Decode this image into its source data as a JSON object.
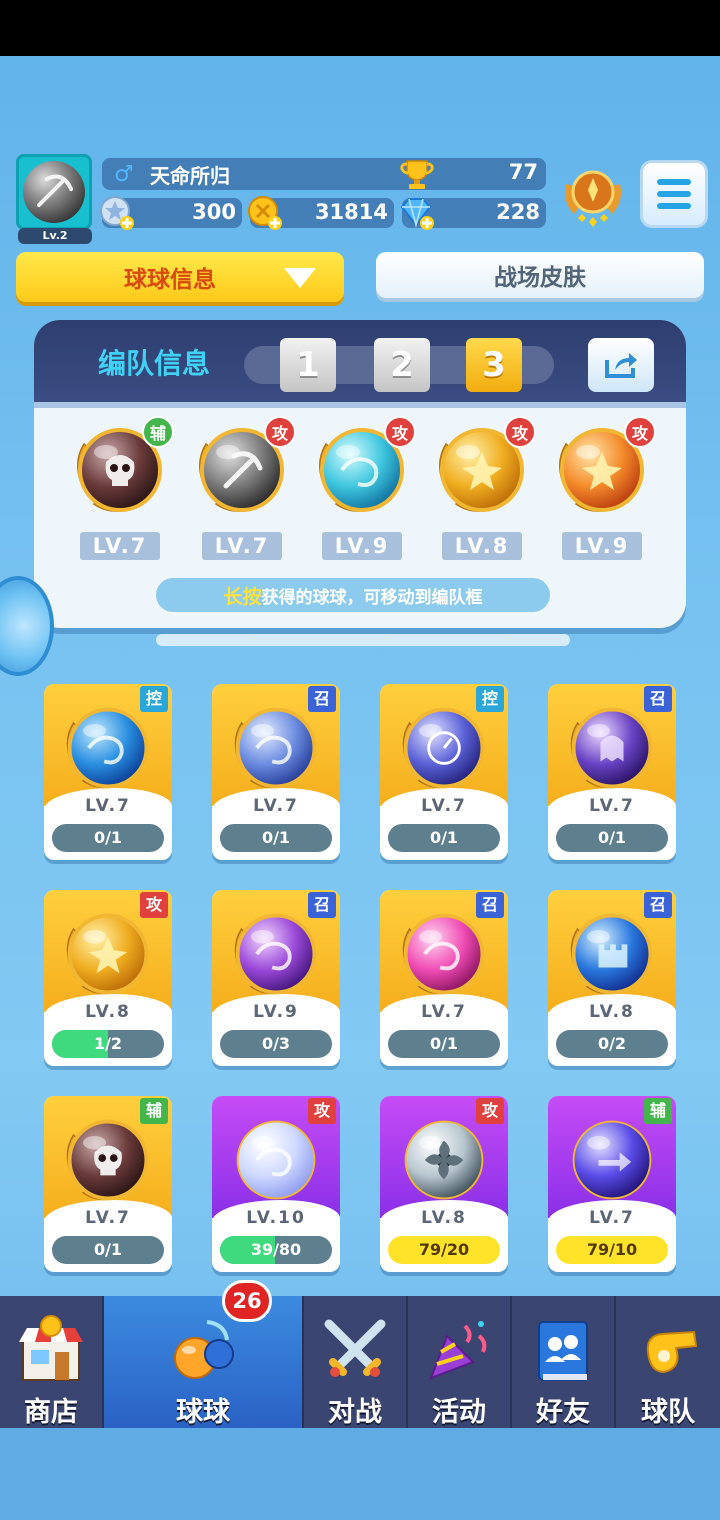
{
  "player": {
    "level": "Lv.2",
    "gender_symbol": "♂",
    "name": "天命所归",
    "trophies": "77"
  },
  "resources": {
    "stars": "300",
    "coins": "31814",
    "diamonds": "228"
  },
  "tabs": {
    "primary": "球球信息",
    "secondary": "战场皮肤"
  },
  "team": {
    "title": "编队信息",
    "slots": [
      "1",
      "2",
      "3"
    ],
    "active_slot": "3",
    "balls": [
      {
        "tag": "辅",
        "level": "LV.7",
        "icon": "skull-ball-icon"
      },
      {
        "tag": "攻",
        "level": "LV.7",
        "icon": "pickaxe-ball-icon"
      },
      {
        "tag": "攻",
        "level": "LV.9",
        "icon": "vortex-ball-icon"
      },
      {
        "tag": "攻",
        "level": "LV.8",
        "icon": "golden-star-ball-icon"
      },
      {
        "tag": "攻",
        "level": "LV.9",
        "icon": "sun-ball-icon"
      }
    ],
    "hint_highlight": "长按",
    "hint_rest": "获得的球球，可移动到编队框"
  },
  "collection": [
    {
      "tag": "控",
      "level": "LV.7",
      "progress": "0/1",
      "fraction": 0,
      "theme": "gold",
      "icon": "wave-ball-icon"
    },
    {
      "tag": "召",
      "level": "LV.7",
      "progress": "0/1",
      "fraction": 0,
      "theme": "gold",
      "icon": "tornado-ball-icon"
    },
    {
      "tag": "控",
      "level": "LV.7",
      "progress": "0/1",
      "fraction": 0,
      "theme": "gold",
      "icon": "clock-ball-icon"
    },
    {
      "tag": "召",
      "level": "LV.7",
      "progress": "0/1",
      "fraction": 0,
      "theme": "gold",
      "icon": "ghost-ball-icon"
    },
    {
      "tag": "攻",
      "level": "LV.8",
      "progress": "1/2",
      "fraction": 0.5,
      "theme": "gold",
      "icon": "golden-star-ball-icon"
    },
    {
      "tag": "召",
      "level": "LV.9",
      "progress": "0/3",
      "fraction": 0,
      "theme": "gold",
      "icon": "galaxy-ball-icon"
    },
    {
      "tag": "召",
      "level": "LV.7",
      "progress": "0/1",
      "fraction": 0,
      "theme": "gold",
      "icon": "pink-ball-icon"
    },
    {
      "tag": "召",
      "level": "LV.8",
      "progress": "0/2",
      "fraction": 0,
      "theme": "gold",
      "icon": "ice-castle-ball-icon"
    },
    {
      "tag": "辅",
      "level": "LV.7",
      "progress": "0/1",
      "fraction": 0,
      "theme": "gold",
      "icon": "skull-ball-icon"
    },
    {
      "tag": "攻",
      "level": "LV.10",
      "progress": "39/80",
      "fraction": 0.49,
      "theme": "purple",
      "icon": "moon-ball-icon"
    },
    {
      "tag": "攻",
      "level": "LV.8",
      "progress": "79/20",
      "fraction": 1,
      "theme": "purple",
      "icon": "fan-ball-icon"
    },
    {
      "tag": "辅",
      "level": "LV.7",
      "progress": "79/10",
      "fraction": 1,
      "theme": "purple",
      "icon": "arrow-ball-icon"
    }
  ],
  "nav": {
    "items": [
      {
        "label": "商店",
        "icon": "shop-icon"
      },
      {
        "label": "球球",
        "icon": "balls-icon"
      },
      {
        "label": "对战",
        "icon": "crossed-swords-icon"
      },
      {
        "label": "活动",
        "icon": "party-popper-icon"
      },
      {
        "label": "好友",
        "icon": "friends-book-icon"
      },
      {
        "label": "球队",
        "icon": "whistle-icon"
      }
    ],
    "active": "球球",
    "badge": "26"
  },
  "colors": {
    "tag_ctrl": "#2aa7d8",
    "tag_summon": "#3b63d8",
    "tag_attack": "#e0413e",
    "tag_support": "#43b54b",
    "progress_fill": "#3fd97e",
    "progress_full": "#ffe328"
  }
}
